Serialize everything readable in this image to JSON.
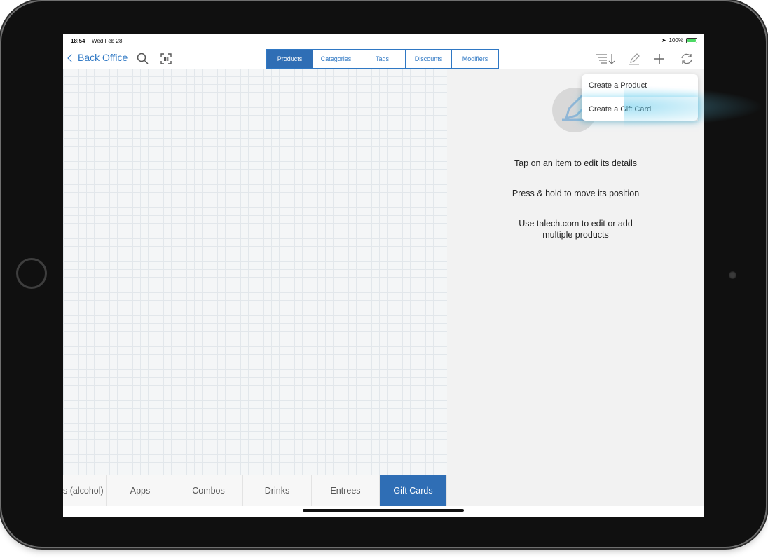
{
  "status_bar": {
    "time": "18:54",
    "date": "Wed Feb 28",
    "battery": "100%"
  },
  "nav": {
    "back_label": "Back Office",
    "tabs": [
      {
        "label": "Products",
        "active": true
      },
      {
        "label": "Categories",
        "active": false
      },
      {
        "label": "Tags",
        "active": false
      },
      {
        "label": "Discounts",
        "active": false
      },
      {
        "label": "Modifiers",
        "active": false
      }
    ],
    "icons": [
      "search-icon",
      "barcode-scan-icon",
      "sort-icon",
      "edit-icon",
      "plus-icon",
      "sync-icon"
    ]
  },
  "dropdown": {
    "items": [
      {
        "label": "Create a Product"
      },
      {
        "label": "Create a Gift Card"
      }
    ]
  },
  "instructions": {
    "line1": "Tap on an item to edit its details",
    "line2": "Press & hold to move its position",
    "line3a": "Use talech.com to edit or add",
    "line3b": "multiple products"
  },
  "categories": [
    {
      "label": "s (alcohol)",
      "active": false
    },
    {
      "label": "Apps",
      "active": false
    },
    {
      "label": "Combos",
      "active": false
    },
    {
      "label": "Drinks",
      "active": false
    },
    {
      "label": "Entrees",
      "active": false
    },
    {
      "label": "Gift Cards",
      "active": true
    }
  ],
  "colors": {
    "accent": "#2f78c4",
    "active_tab": "#2f6eb5",
    "glow": "#5cc8eb"
  }
}
